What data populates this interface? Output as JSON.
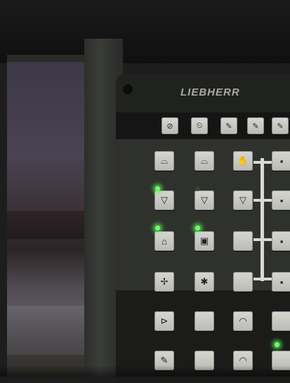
{
  "panel": {
    "brand": "LIEBHERR"
  },
  "top_keys": [
    {
      "icon": "scale-icon",
      "glyph": "⊘"
    },
    {
      "icon": "timer-icon",
      "glyph": "⏲"
    },
    {
      "icon": "wrench-icon",
      "glyph": "✎"
    },
    {
      "icon": "tool-icon",
      "glyph": "✎"
    },
    {
      "icon": "tool-icon",
      "glyph": "✎"
    }
  ],
  "keys": [
    {
      "icon": "wiper-front-icon",
      "glyph": "⌓"
    },
    {
      "icon": "wiper-roof-icon",
      "glyph": "⌓"
    },
    {
      "icon": "hand-icon",
      "glyph": "✋"
    },
    {
      "icon": "camera-icon",
      "glyph": "▪"
    },
    {
      "icon": "washer-icon",
      "glyph": "▽"
    },
    {
      "icon": "washer-icon",
      "glyph": "▽"
    },
    {
      "icon": "washer-icon",
      "glyph": "▽"
    },
    {
      "icon": "camera-icon",
      "glyph": "▪"
    },
    {
      "icon": "boom-light-icon",
      "glyph": "⌂"
    },
    {
      "icon": "cab-light-icon",
      "glyph": "▣"
    },
    {
      "icon": "blank-icon",
      "glyph": ""
    },
    {
      "icon": "camera-icon",
      "glyph": "▪"
    },
    {
      "icon": "crane-icon",
      "glyph": "✢"
    },
    {
      "icon": "fan-icon",
      "glyph": "✱"
    },
    {
      "icon": "blank-icon",
      "glyph": ""
    },
    {
      "icon": "camera-icon",
      "glyph": "▪"
    },
    {
      "icon": "gauge-icon",
      "glyph": "⊳"
    },
    {
      "icon": "blank-icon",
      "glyph": ""
    },
    {
      "icon": "gauge-icon",
      "glyph": "◠"
    },
    {
      "icon": "blank-icon",
      "glyph": ""
    },
    {
      "icon": "tool-icon",
      "glyph": "✎"
    },
    {
      "icon": "blank-icon",
      "glyph": ""
    },
    {
      "icon": "gauge-icon",
      "glyph": "◠"
    },
    {
      "icon": "blank-icon",
      "glyph": ""
    }
  ],
  "leds": [
    {
      "name": "status-led",
      "on": true
    },
    {
      "name": "status-led",
      "on": false
    },
    {
      "name": "status-led",
      "on": true
    },
    {
      "name": "status-led",
      "on": true
    },
    {
      "name": "status-led",
      "on": true
    }
  ]
}
